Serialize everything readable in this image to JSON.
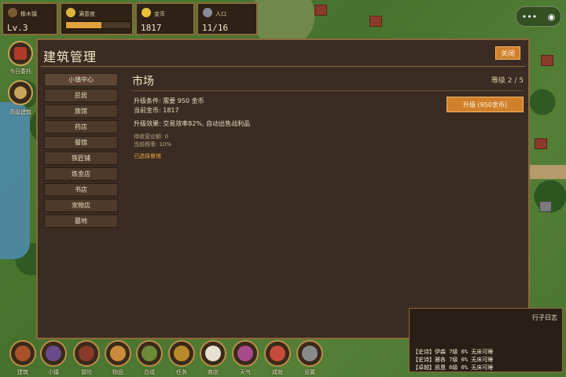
{
  "hud": {
    "town": {
      "label": "橡木镇",
      "value": "Lv.3"
    },
    "satisfaction": {
      "label": "满意度",
      "percent": 55
    },
    "gold": {
      "label": "金币",
      "value": "1817"
    },
    "population": {
      "label": "人口",
      "value": "11/16"
    }
  },
  "capsule": {
    "menu": "•••",
    "target": "◉"
  },
  "left_buttons": [
    {
      "label": "今日委托",
      "icon": "shrine-icon"
    },
    {
      "label": "高级建筑",
      "icon": "hourglass-icon"
    }
  ],
  "panel": {
    "title": "建筑管理",
    "close_label": "关闭",
    "sidebar": [
      "小镇中心",
      "民居",
      "旅馆",
      "药店",
      "餐馆",
      "铁匠铺",
      "炼金店",
      "书店",
      "宠物店",
      "墓地"
    ],
    "active_index": 0,
    "building": {
      "name": "市场",
      "level_text": "等级 2 / 5",
      "upgrade_req": "升级条件: 需要 950 金币",
      "current_gold": "当前金币: 1817",
      "upgrade_effect": "升级效果: 交易效率82%, 自动出售战利品",
      "pending_income": "待收营业额: 0",
      "tax_rate": "当前税率: 10%",
      "selected_note": "已选择餐馆",
      "upgrade_button": "升级 (950金币)"
    }
  },
  "log": {
    "title": "行子日志",
    "rows": [
      "【史诗】伊森   7级  0%  无床可睡",
      "【史诗】雅各   7级  0%  无床可睡",
      "【卓越】凯恩   6级  0%  无床可睡"
    ]
  },
  "bottom_bar": [
    "建筑",
    "小镇",
    "冒险",
    "物品",
    "合成",
    "任务",
    "商店",
    "天气",
    "成就",
    "设置"
  ]
}
